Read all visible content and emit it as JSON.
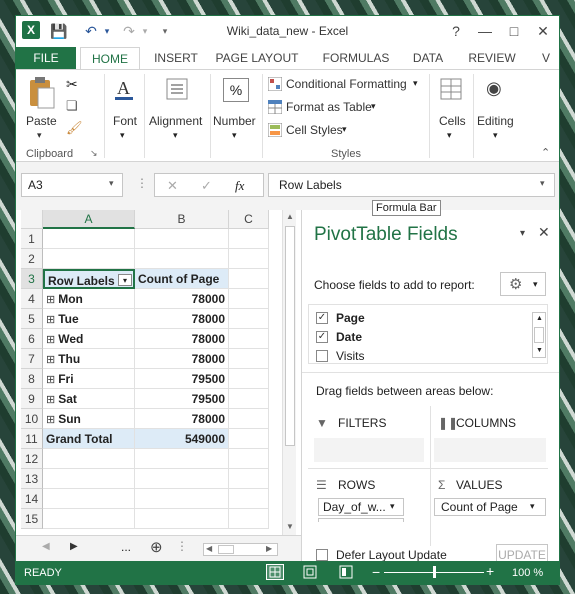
{
  "window": {
    "title": "Wiki_data_new - Excel",
    "controls": [
      "?",
      "—",
      "□",
      "✕"
    ]
  },
  "tabs": [
    "FILE",
    "HOME",
    "INSERT",
    "PAGE LAYOUT",
    "FORMULAS",
    "DATA",
    "REVIEW",
    "V"
  ],
  "ribbon": {
    "clipboard": {
      "label": "Clipboard",
      "paste": "Paste"
    },
    "font": {
      "label": "Font"
    },
    "alignment": {
      "label": "Alignment"
    },
    "number": {
      "label": "Number",
      "symbol": "%"
    },
    "styles": {
      "label": "Styles",
      "conditional": "Conditional Formatting",
      "format_table": "Format as Table",
      "cell_styles": "Cell Styles"
    },
    "cells": {
      "label": "Cells"
    },
    "editing": {
      "label": "Editing"
    }
  },
  "formula_bar": {
    "name_box": "A3",
    "content": "Row Labels",
    "tooltip": "Formula Bar",
    "fx": "fx"
  },
  "grid": {
    "columns": [
      "A",
      "B",
      "C"
    ],
    "rows": [
      {
        "n": "1",
        "a": "",
        "b": ""
      },
      {
        "n": "2",
        "a": "",
        "b": ""
      },
      {
        "n": "3",
        "a": "Row Labels",
        "b": "Count of Page"
      },
      {
        "n": "4",
        "a": "Mon",
        "b": "78000"
      },
      {
        "n": "5",
        "a": "Tue",
        "b": "78000"
      },
      {
        "n": "6",
        "a": "Wed",
        "b": "78000"
      },
      {
        "n": "7",
        "a": "Thu",
        "b": "78000"
      },
      {
        "n": "8",
        "a": "Fri",
        "b": "79500"
      },
      {
        "n": "9",
        "a": "Sat",
        "b": "79500"
      },
      {
        "n": "10",
        "a": "Sun",
        "b": "78000"
      },
      {
        "n": "11",
        "a": "Grand Total",
        "b": "549000"
      },
      {
        "n": "12",
        "a": "",
        "b": ""
      },
      {
        "n": "13",
        "a": "",
        "b": ""
      },
      {
        "n": "14",
        "a": "",
        "b": ""
      },
      {
        "n": "15",
        "a": "",
        "b": ""
      }
    ],
    "expand_symbol": "⊞",
    "more": "...",
    "add": "⊕"
  },
  "pivot": {
    "title": "PivotTable Fields",
    "choose": "Choose fields to add to report:",
    "fields": [
      {
        "name": "Page",
        "checked": true
      },
      {
        "name": "Date",
        "checked": true
      },
      {
        "name": "Visits",
        "checked": false
      }
    ],
    "drag": "Drag fields between areas below:",
    "filters": "FILTERS",
    "columns": "COLUMNS",
    "rows": "ROWS",
    "values": "VALUES",
    "rows_item": "Day_of_w...",
    "values_item": "Count of Page",
    "defer": "Defer Layout Update",
    "update": "UPDATE"
  },
  "status": {
    "ready": "READY",
    "zoom": "100 %",
    "zoom_level": 100
  },
  "colors": {
    "excel_green": "#217346",
    "header_band": "#ddebf7"
  }
}
